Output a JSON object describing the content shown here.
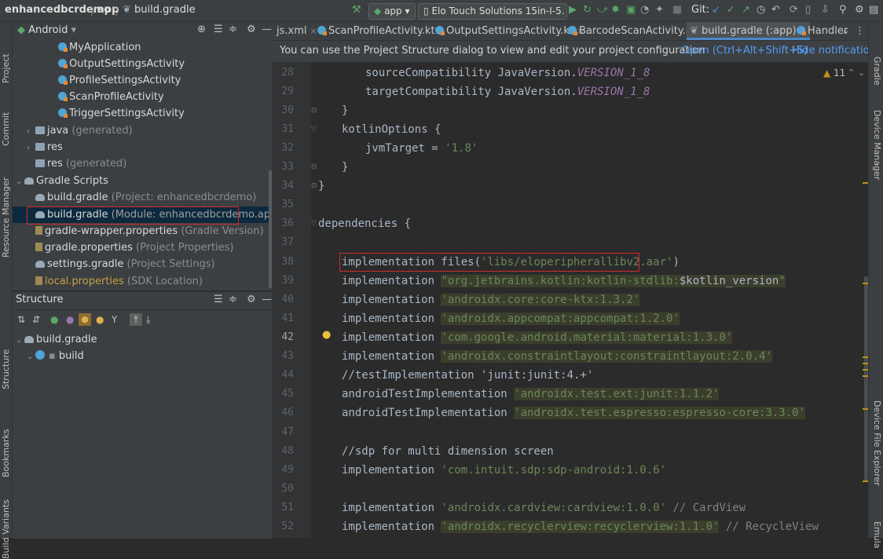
{
  "navbar": {
    "crumbs": [
      "enhancedbcrdemo",
      "app",
      "build.gradle"
    ],
    "run_config": "app",
    "device": "Elo Touch Solutions 15in-I-5.",
    "git_label": "Git:"
  },
  "left_strip": [
    "Project",
    "Commit",
    "Resource Manager",
    "Structure",
    "Bookmarks",
    "Build Variants"
  ],
  "right_strip": [
    "Gradle",
    "Device Manager",
    "Device File Explorer",
    "Emula"
  ],
  "project_panel": {
    "view": "Android",
    "items": [
      {
        "label": "MyApplication",
        "hint": ""
      },
      {
        "label": "OutputSettingsActivity",
        "hint": ""
      },
      {
        "label": "ProfileSettingsActivity",
        "hint": ""
      },
      {
        "label": "ScanProfileActivity",
        "hint": ""
      },
      {
        "label": "TriggerSettingsActivity",
        "hint": ""
      },
      {
        "label": "java",
        "hint": "(generated)"
      },
      {
        "label": "res",
        "hint": ""
      },
      {
        "label": "res",
        "hint": "(generated)"
      },
      {
        "label": "Gradle Scripts",
        "hint": ""
      },
      {
        "label": "build.gradle",
        "hint": "(Project: enhancedbcrdemo)"
      },
      {
        "label": "build.gradle",
        "hint": "(Module: enhancedbcrdemo.app)"
      },
      {
        "label": "gradle-wrapper.properties",
        "hint": "(Gradle Version)"
      },
      {
        "label": "gradle.properties",
        "hint": "(Project Properties)"
      },
      {
        "label": "settings.gradle",
        "hint": "(Project Settings)"
      },
      {
        "label": "local.properties",
        "hint": "(SDK Location)"
      }
    ]
  },
  "structure_panel": {
    "title": "Structure",
    "root": "build.gradle",
    "child": "build"
  },
  "editor_tabs": [
    {
      "label": "js.xml"
    },
    {
      "label": "ScanProfileActivity.kt"
    },
    {
      "label": "OutputSettingsActivity.kt"
    },
    {
      "label": "BarcodeScanActivity.kt"
    },
    {
      "label": "build.gradle (:app)"
    },
    {
      "label": "Handler"
    }
  ],
  "banner": {
    "message": "You can use the Project Structure dialog to view and edit your project configuration",
    "open_link": "Open (Ctrl+Alt+Shift+S)",
    "hide_link": "Hide notification"
  },
  "warnings_count": "11",
  "code": {
    "line_numbers": [
      "28",
      "29",
      "30",
      "31",
      "32",
      "33",
      "34",
      "35",
      "36",
      "37",
      "38",
      "39",
      "40",
      "41",
      "42",
      "43",
      "44",
      "45",
      "46",
      "47",
      "48",
      "49",
      "50",
      "51",
      "52"
    ],
    "l28": "sourceCompatibility JavaVersion.",
    "l28v": "VERSION_1_8",
    "l29": "targetCompatibility JavaVersion.",
    "l29v": "VERSION_1_8",
    "l30": "}",
    "l31": "kotlinOptions {",
    "l32a": "jvmTarget = ",
    "l32s": "'1.8'",
    "l33": "}",
    "l34": "}",
    "l36": "dependencies {",
    "l38a": "implementation files(",
    "l38s": "'libs/eloperipherallibv2.aar'",
    "l38b": ")",
    "impl": "implementation ",
    "l39s": "\"org.jetbrains.kotlin:kotlin-stdlib:",
    "l39v": "$kotlin_version",
    "l39e": "\"",
    "l40s": "'androidx.core:core-ktx:1.3.2'",
    "l41s": "'androidx.appcompat:appcompat:1.2.0'",
    "l42s": "'com.google.android.material:material:1.3.0'",
    "l43s": "'androidx.constraintlayout:constraintlayout:2.0.4'",
    "l44": "//testImplementation 'junit:junit:4.+'",
    "l45a": "androidTestImplementation ",
    "l45s": "'androidx.test.ext:junit:1.1.2'",
    "l46s": "'androidx.test.espresso:espresso-core:3.3.0'",
    "l48": "//sdp for multi dimension screen",
    "l49s": "'com.intuit.sdp:sdp-android:1.0.6'",
    "l51s": "'androidx.cardview:cardview:1.0.0'",
    "l51c": " // CardView",
    "l52s": "'androidx.recyclerview:recyclerview:1.1.0'",
    "l52c": " // RecycleView"
  }
}
